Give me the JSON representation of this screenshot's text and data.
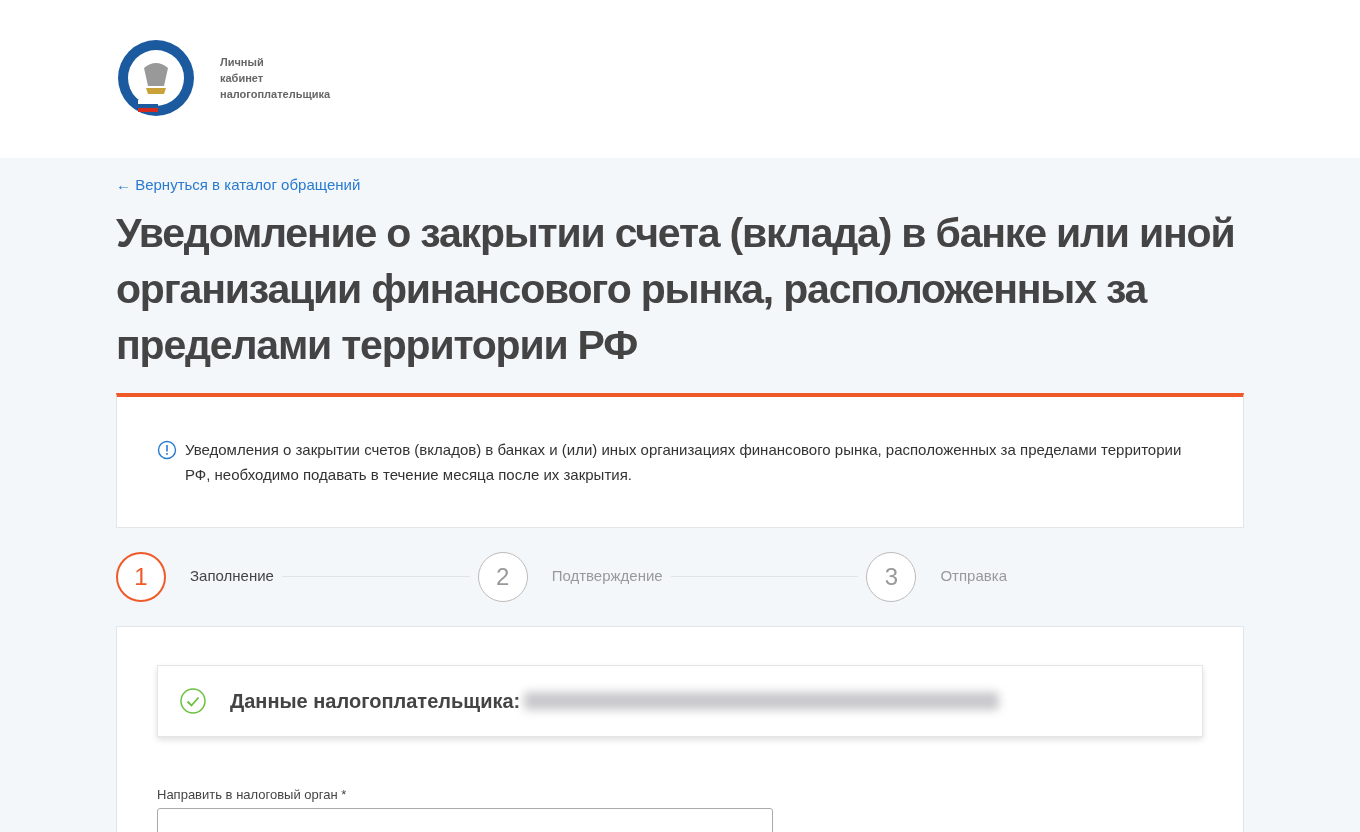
{
  "header": {
    "logo_caption": [
      "Личный",
      "кабинет",
      "налогоплательщика"
    ]
  },
  "back_link": "← Вернуться в каталог обращений",
  "title": "Уведомление о закрытии счета (вклада) в банке или иной организации финансового рынка, расположенных за пределами территории РФ",
  "notice": {
    "text": "Уведомления о закрытии счетов (вкладов) в банках и (или) иных организациях финансового рынка, расположенных за пределами территории РФ, необходимо подавать в течение месяца после их закрытия."
  },
  "steps": [
    {
      "number": "1",
      "label": "Заполнение",
      "current": true
    },
    {
      "number": "2",
      "label": "Подтверждение",
      "current": false
    },
    {
      "number": "3",
      "label": "Отправка",
      "current": false
    }
  ],
  "form": {
    "taxpayer": {
      "label": "Данные налогоплательщика:",
      "verified": true
    },
    "fields": [
      {
        "label": "Направить в налоговый орган *"
      }
    ]
  }
}
